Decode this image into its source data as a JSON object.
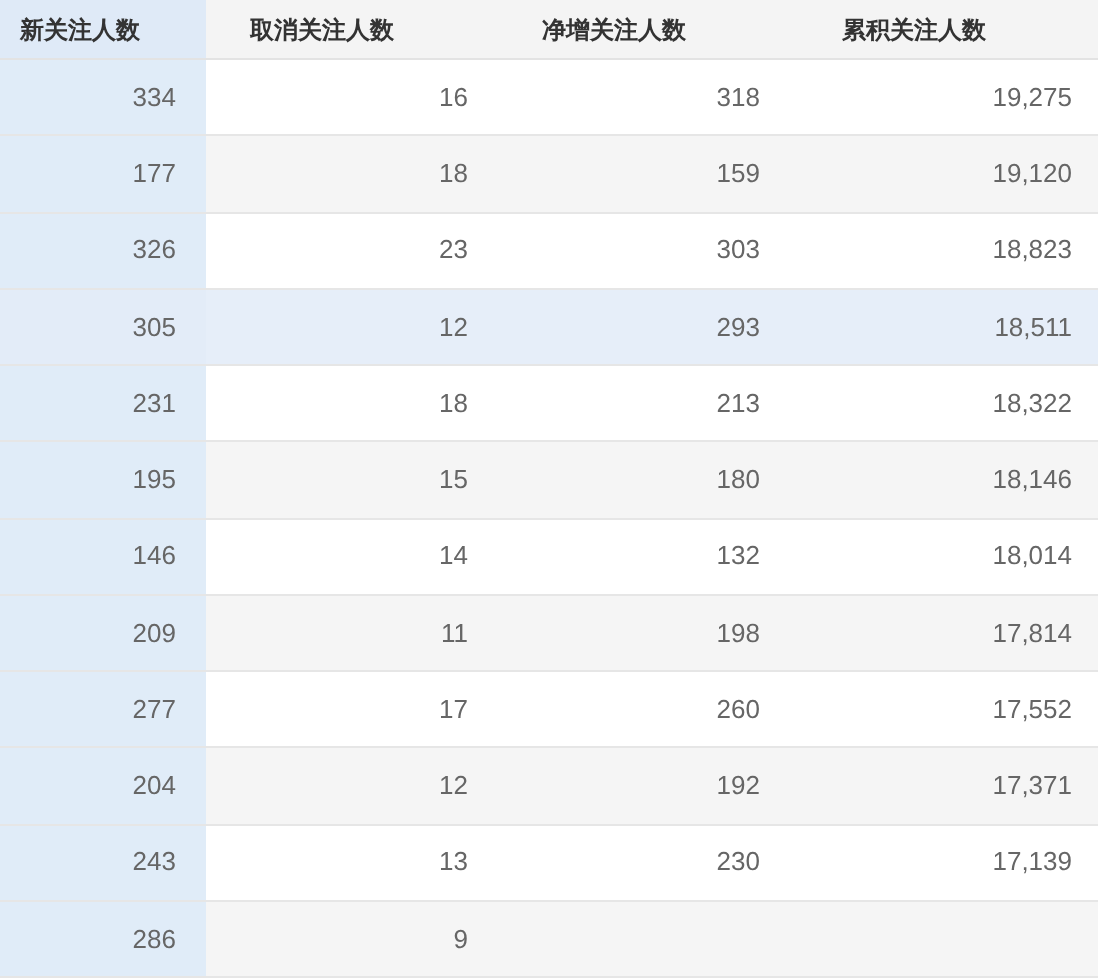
{
  "table": {
    "columns": [
      "新关注人数",
      "取消关注人数",
      "净增关注人数",
      "累积关注人数"
    ],
    "rows": [
      {
        "cells": [
          "334",
          "16",
          "318",
          "19,275"
        ],
        "selected": false
      },
      {
        "cells": [
          "177",
          "18",
          "159",
          "19,120"
        ],
        "selected": false
      },
      {
        "cells": [
          "326",
          "23",
          "303",
          "18,823"
        ],
        "selected": false
      },
      {
        "cells": [
          "305",
          "12",
          "293",
          "18,511"
        ],
        "selected": true
      },
      {
        "cells": [
          "231",
          "18",
          "213",
          "18,322"
        ],
        "selected": false
      },
      {
        "cells": [
          "195",
          "15",
          "180",
          "18,146"
        ],
        "selected": false
      },
      {
        "cells": [
          "146",
          "14",
          "132",
          "18,014"
        ],
        "selected": false
      },
      {
        "cells": [
          "209",
          "11",
          "198",
          "17,814"
        ],
        "selected": false
      },
      {
        "cells": [
          "277",
          "17",
          "260",
          "17,552"
        ],
        "selected": false
      },
      {
        "cells": [
          "204",
          "12",
          "192",
          "17,371"
        ],
        "selected": false
      },
      {
        "cells": [
          "243",
          "13",
          "230",
          "17,139"
        ],
        "selected": false
      },
      {
        "cells": [
          "286",
          "9"
        ],
        "selected": false
      }
    ]
  }
}
